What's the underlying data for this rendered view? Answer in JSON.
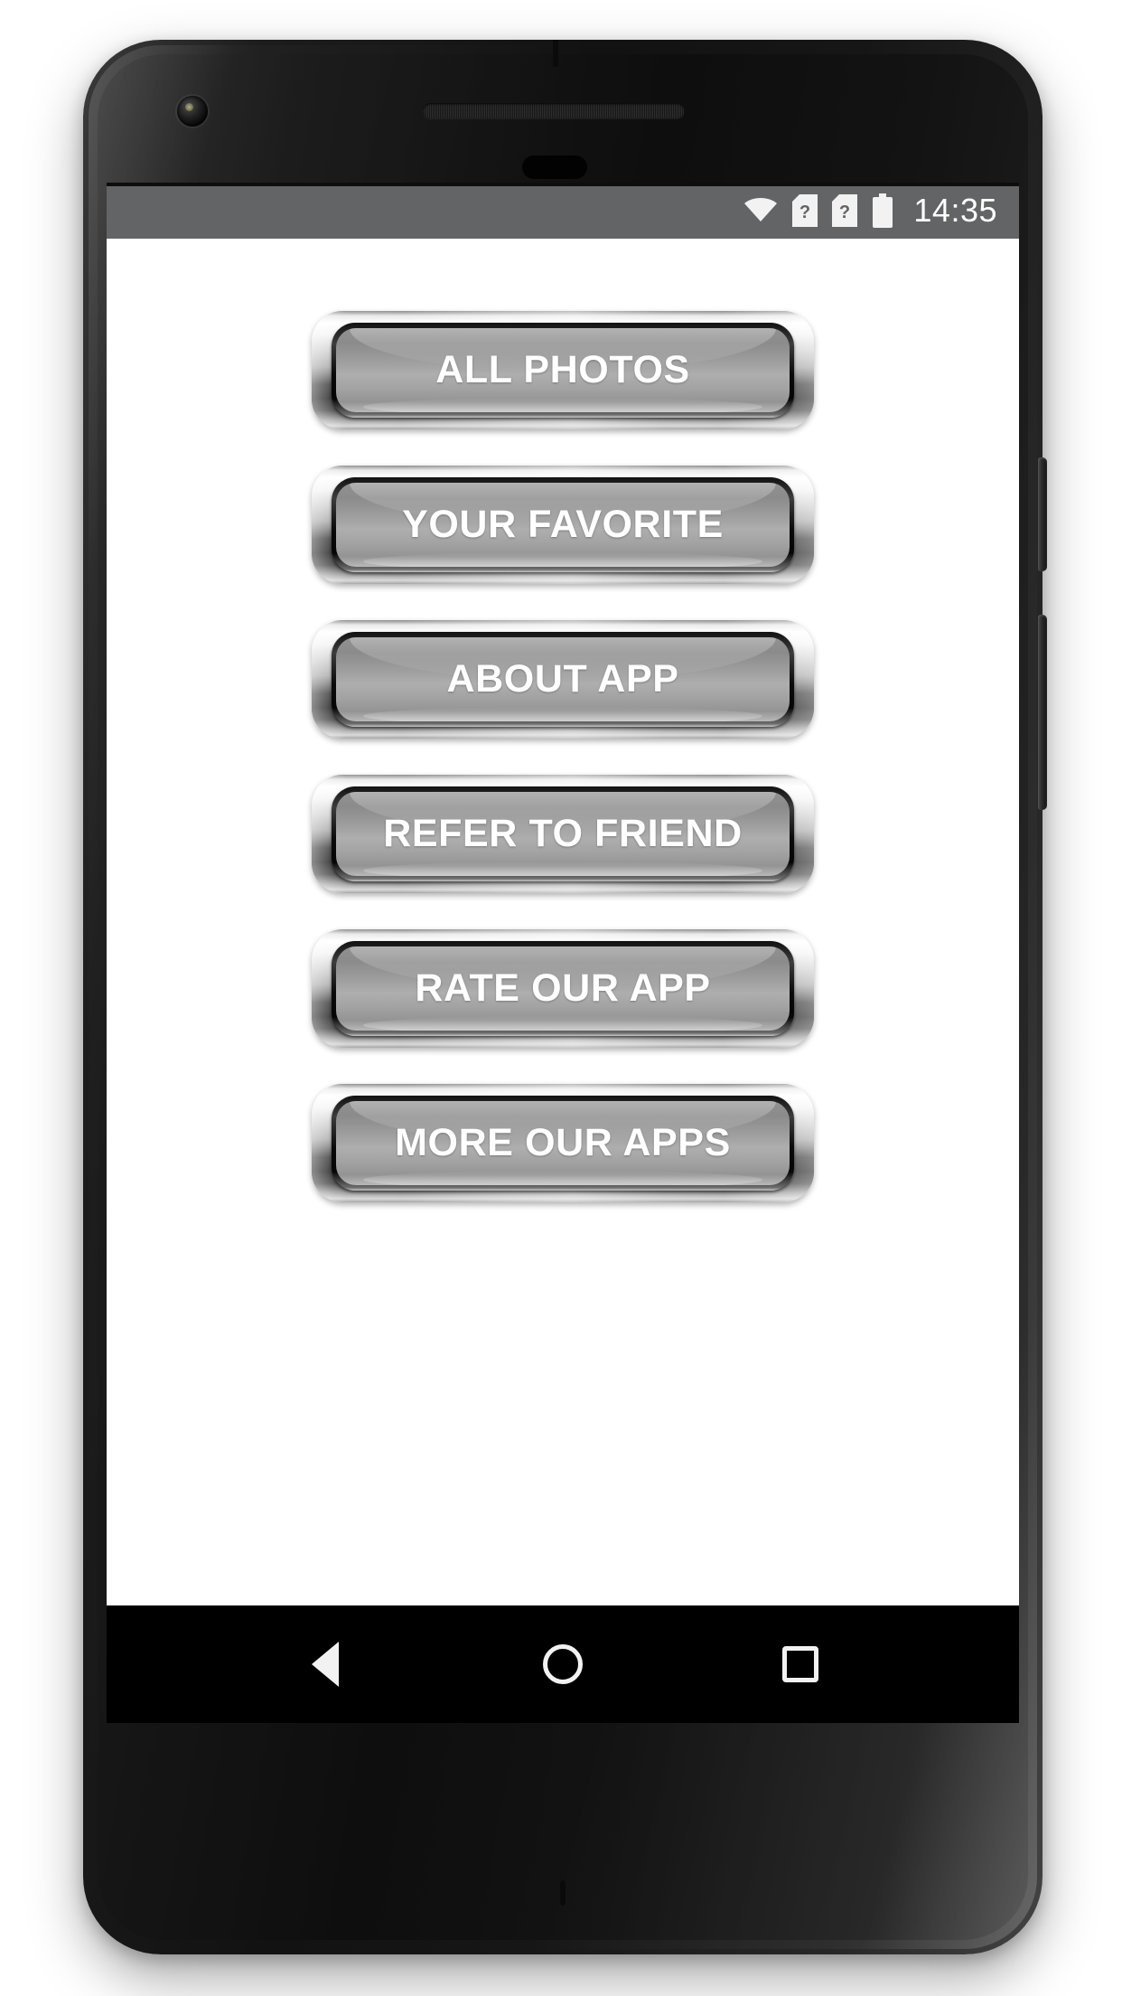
{
  "device": {
    "name": "android-phone-mockup",
    "frame_color": "#1a1a1a",
    "screen_background": "#ffffff",
    "hardware": {
      "front_camera": "front-camera",
      "earpiece": "earpiece-speaker",
      "proximity_sensor": "proximity-sensor",
      "power_button": "power-button",
      "volume_rocker": "volume-rocker"
    }
  },
  "status_bar": {
    "background": "#636466",
    "time": "14:35",
    "icons": [
      {
        "name": "wifi-icon",
        "label": "wifi"
      },
      {
        "name": "sim-card-unknown-icon-1",
        "label": "?"
      },
      {
        "name": "sim-card-unknown-icon-2",
        "label": "?"
      },
      {
        "name": "battery-icon",
        "label": "battery"
      }
    ]
  },
  "app": {
    "background": "#ffffff",
    "button_text_color": "#ffffff",
    "button_face_color": "#a0a0a0",
    "button_bezel_color": "#d8d8d8",
    "menu_buttons": [
      {
        "id": "all-photos",
        "label": "ALL PHOTOS"
      },
      {
        "id": "your-favorite",
        "label": "YOUR FAVORITE"
      },
      {
        "id": "about-app",
        "label": "ABOUT APP"
      },
      {
        "id": "refer-to-friend",
        "label": "REFER TO FRIEND"
      },
      {
        "id": "rate-our-app",
        "label": "RATE OUR APP"
      },
      {
        "id": "more-our-apps",
        "label": "MORE OUR APPS"
      }
    ]
  },
  "navigation_bar": {
    "background": "#000000",
    "keys": [
      {
        "id": "back",
        "icon": "back-triangle-icon"
      },
      {
        "id": "home",
        "icon": "home-circle-icon"
      },
      {
        "id": "recents",
        "icon": "recents-square-icon"
      }
    ]
  }
}
